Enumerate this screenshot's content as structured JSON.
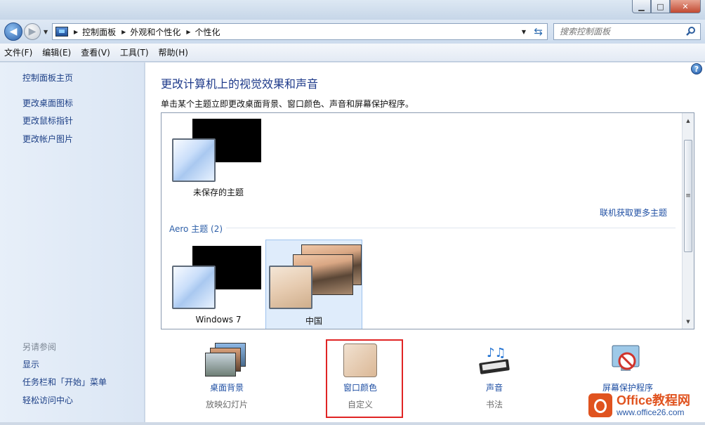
{
  "window": {
    "min_glyph": "▁",
    "max_glyph": "□",
    "close_glyph": "✕"
  },
  "address_bar": {
    "breadcrumbs": [
      "控制面板",
      "外观和个性化",
      "个性化"
    ],
    "search_placeholder": "搜索控制面板"
  },
  "menu": [
    "文件(F)",
    "编辑(E)",
    "查看(V)",
    "工具(T)",
    "帮助(H)"
  ],
  "sidebar": {
    "links": [
      "控制面板主页",
      "更改桌面图标",
      "更改鼠标指针",
      "更改帐户图片"
    ],
    "see_also_title": "另请参阅",
    "see_also": [
      "显示",
      "任务栏和「开始」菜单",
      "轻松访问中心"
    ]
  },
  "main": {
    "title": "更改计算机上的视觉效果和声音",
    "subtitle": "单击某个主题立即更改桌面背景、窗口颜色、声音和屏幕保护程序。",
    "unsaved_theme": "未保存的主题",
    "more_themes_link": "联机获取更多主题",
    "aero_group": "Aero 主题 (2)",
    "themes": [
      "Windows 7",
      "中国"
    ]
  },
  "options": [
    {
      "label": "桌面背景",
      "sub": "放映幻灯片"
    },
    {
      "label": "窗口颜色",
      "sub": "自定义"
    },
    {
      "label": "声音",
      "sub": "书法"
    },
    {
      "label": "屏幕保护程序",
      "sub": ""
    }
  ],
  "watermark": {
    "line1": "Office教程网",
    "line2": "www.office26.com"
  }
}
